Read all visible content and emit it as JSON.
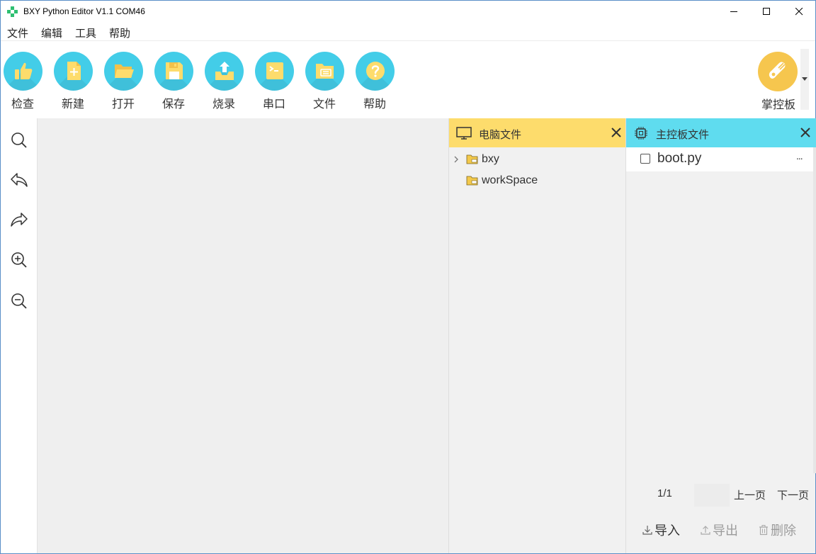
{
  "window": {
    "title": "BXY Python Editor V1.1 COM46"
  },
  "menu": [
    "文件",
    "编辑",
    "工具",
    "帮助"
  ],
  "toolbar": {
    "tools": [
      {
        "icon": "thumbs-up-icon",
        "label": "检查"
      },
      {
        "icon": "new-file-icon",
        "label": "新建"
      },
      {
        "icon": "open-folder-icon",
        "label": "打开"
      },
      {
        "icon": "save-icon",
        "label": "保存"
      },
      {
        "icon": "upload-icon",
        "label": "烧录"
      },
      {
        "icon": "terminal-icon",
        "label": "串口"
      },
      {
        "icon": "files-icon",
        "label": "文件"
      },
      {
        "icon": "help-icon",
        "label": "帮助"
      }
    ],
    "board": {
      "icon": "board-icon",
      "label": "掌控板"
    }
  },
  "sidebar": [
    "search-icon",
    "undo-icon",
    "redo-icon",
    "zoom-in-icon",
    "zoom-out-icon"
  ],
  "pc_panel": {
    "title": "电脑文件",
    "items": [
      {
        "label": "bxy",
        "expandable": true
      },
      {
        "label": "workSpace",
        "expandable": false
      }
    ]
  },
  "board_panel": {
    "title": "主控板文件",
    "files": [
      {
        "name": "boot.py",
        "more": "..."
      }
    ],
    "pager": {
      "page": "1/1",
      "prev": "上一页",
      "next": "下一页"
    },
    "actions": {
      "import": "导入",
      "export": "导出",
      "delete": "删除"
    }
  },
  "colors": {
    "tool_blue": "#43cde8",
    "pc_header": "#fddc6c",
    "board_header": "#5fdcef",
    "board_gold": "#f6c64e"
  }
}
